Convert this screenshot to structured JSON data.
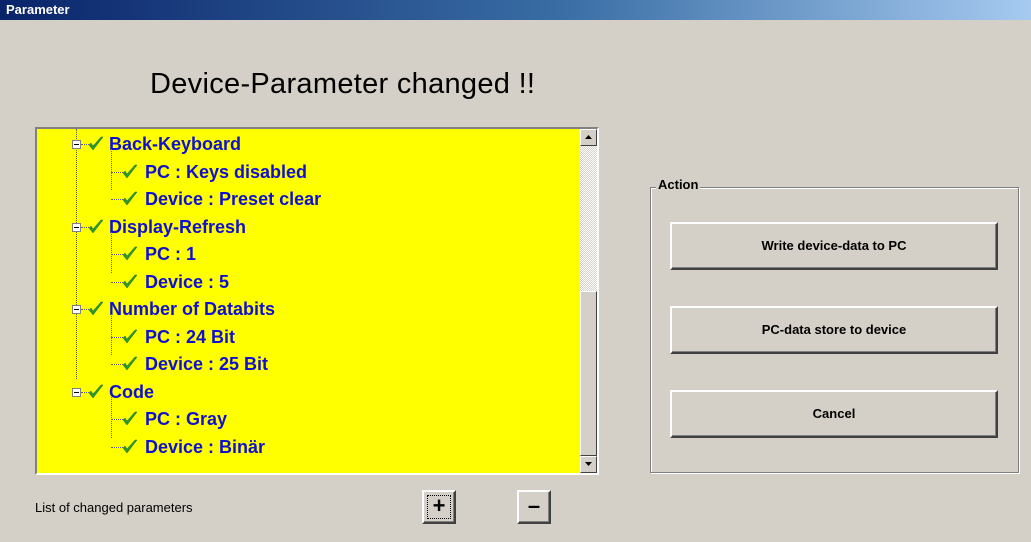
{
  "window": {
    "title": "Parameter"
  },
  "heading": "Device-Parameter changed !!",
  "tree": {
    "groups": [
      {
        "label": "Back-Keyboard",
        "children": [
          "PC : Keys disabled",
          "Device : Preset clear"
        ]
      },
      {
        "label": "Display-Refresh",
        "children": [
          "PC : 1",
          "Device : 5"
        ]
      },
      {
        "label": "Number of Databits",
        "children": [
          "PC : 24 Bit",
          "Device : 25 Bit"
        ]
      },
      {
        "label": "Code",
        "children": [
          "PC : Gray",
          "Device : Binär"
        ]
      }
    ]
  },
  "action_group": {
    "label": "Action",
    "buttons": {
      "write": "Write device-data to PC",
      "store": "PC-data store to device",
      "cancel": "Cancel"
    }
  },
  "footer": {
    "label": "List of changed parameters",
    "expand_label": "+",
    "collapse_label": "–"
  },
  "colors": {
    "tree_background": "#ffff00",
    "tree_text": "#1010d0",
    "check_mark": "#2e9a2e",
    "title_bar": "#0a246a"
  },
  "icons": {
    "checked": "check-icon",
    "expanded": "minus-box-icon",
    "scroll_up": "arrow-up-icon",
    "scroll_down": "arrow-down-icon"
  }
}
